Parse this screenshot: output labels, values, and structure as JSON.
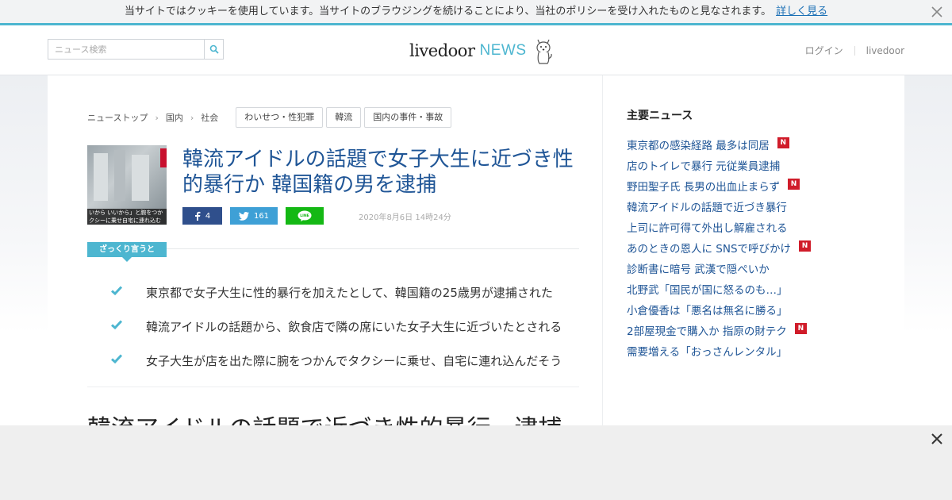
{
  "cookie_bar": {
    "message": "当サイトではクッキーを使用しています。当サイトのブラウジングを続けることにより、当社のポリシーを受け入れたものと見なされます。",
    "link_label": "詳しく見る"
  },
  "header": {
    "search_placeholder": "ニュース検索",
    "logo_livedoor": "livedoor",
    "logo_news": "NEWS",
    "login_label": "ログイン",
    "livedoor_link": "livedoor"
  },
  "breadcrumb": {
    "items": [
      "ニューストップ",
      "国内",
      "社会"
    ],
    "separator": "›"
  },
  "tags": [
    "わいせつ・性犯罪",
    "韓流",
    "国内の事件・事故"
  ],
  "article": {
    "headline": "韓流アイドルの話題で女子大生に近づき性的暴行か 韓国籍の男を逮捕",
    "thumb_caption_1": "いから いいから」と腕をつか",
    "thumb_caption_2": "クシーに乗せ自宅に連れ込む",
    "share": {
      "facebook_count": "4",
      "twitter_count": "161",
      "line_label": "LINE"
    },
    "date": "2020年8月6日 14時24分",
    "summary_label": "ざっくり言うと",
    "points": [
      "東京都で女子大生に性的暴行を加えたとして、韓国籍の25歳男が逮捕された",
      "韓流アイドルの話題から、飲食店で隣の席にいた女子大生に近づいたとされる",
      "女子大生が店を出た際に腕をつかんでタクシーに乗せ、自宅に連れ込んだそう"
    ],
    "subheading": "韓流アイドルの話題で近づき性的暴行　逮捕"
  },
  "sidebar": {
    "title": "主要ニュース",
    "new_badge": "N",
    "items": [
      {
        "label": "東京都の感染経路 最多は同居",
        "is_new": true
      },
      {
        "label": "店のトイレで暴行 元従業員逮捕",
        "is_new": false
      },
      {
        "label": "野田聖子氏 長男の出血止まらず",
        "is_new": true
      },
      {
        "label": "韓流アイドルの話題で近づき暴行",
        "is_new": false
      },
      {
        "label": "上司に許可得て外出し解雇される",
        "is_new": false
      },
      {
        "label": "あのときの恩人に SNSで呼びかけ",
        "is_new": true
      },
      {
        "label": "診断書に暗号 武漢で隠ぺいか",
        "is_new": false
      },
      {
        "label": "北野武「国民が国に怒るのも…」",
        "is_new": false
      },
      {
        "label": "小倉優香は「悪名は無名に勝る」",
        "is_new": false
      },
      {
        "label": "2部屋現金で購入か 指原の財テク",
        "is_new": true
      },
      {
        "label": "需要増える「おっさんレンタル」",
        "is_new": false
      }
    ]
  },
  "colors": {
    "accent": "#4db6d0",
    "link": "#1f5596",
    "facebook": "#2f4f8c",
    "twitter": "#3ea0d6",
    "line": "#14b814",
    "new_badge": "#d01c2a"
  }
}
